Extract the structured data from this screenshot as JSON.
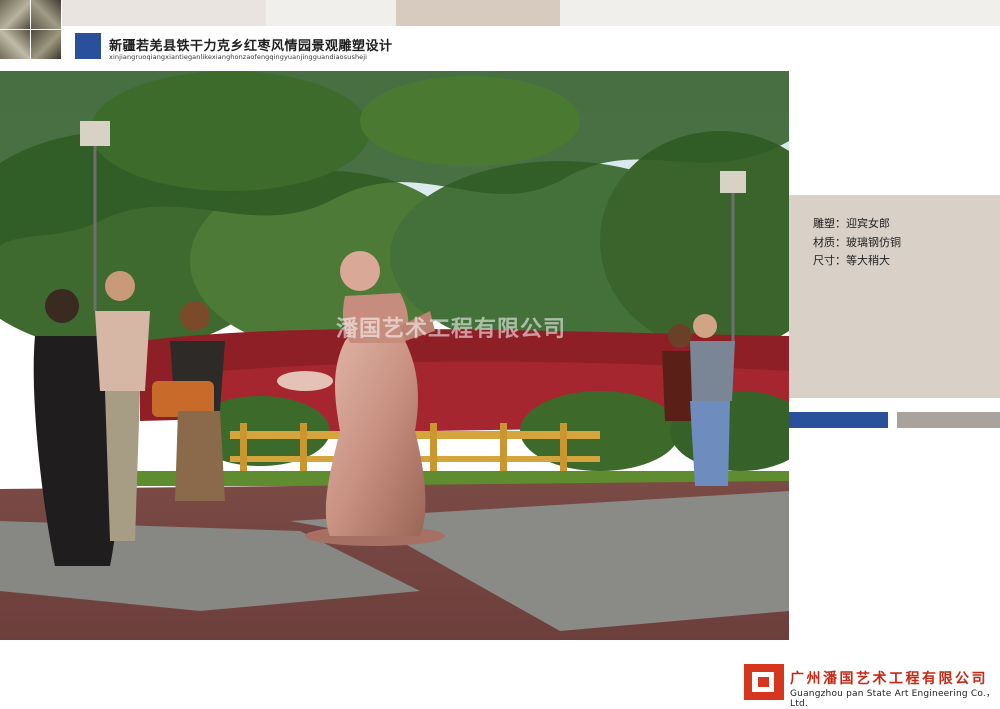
{
  "header": {
    "title": "新疆若羌县铁干力克乡红枣风情园景观雕塑设计",
    "subtitle": "xinjiangruoqiangxiantieganlikexianghonzaofengqingyuanjingguandiaosusheji"
  },
  "scene": {
    "watermark": "潘国艺术工程有限公司"
  },
  "info": {
    "sculpture": "雕塑：迎宾女郎",
    "material": "材质：玻璃钢仿铜",
    "size": "尺寸：等大稍大"
  },
  "footer": {
    "company_cn": "广州潘国艺术工程有限公司",
    "company_en": "Guangzhou pan State Art Engineering Co.， Ltd."
  },
  "colors": {
    "accent_blue": "#2a4f9b",
    "panel_beige": "#d9d0c7",
    "brand_red": "#c52a17"
  }
}
